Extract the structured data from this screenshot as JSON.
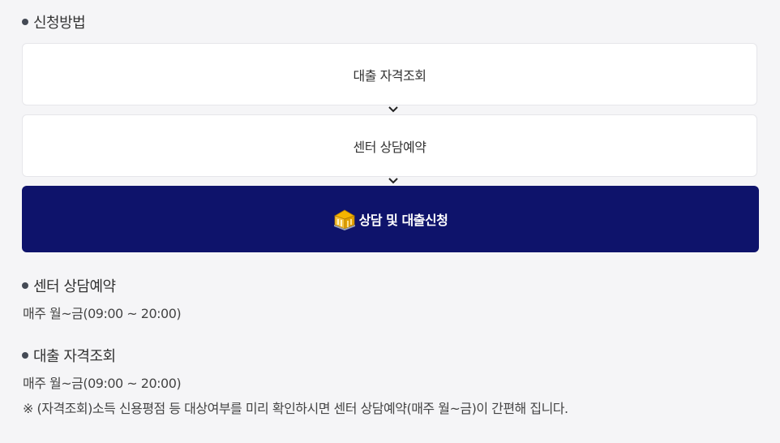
{
  "apply_method": {
    "title": "신청방법",
    "steps": [
      {
        "label": "대출 자격조회"
      },
      {
        "label": "센터 상담예약"
      }
    ],
    "cta_label": "상담 및 대출신청",
    "cta_icon": "building-icon",
    "colors": {
      "cta_background": "#0e136b",
      "page_background": "#f5f5f7"
    }
  },
  "center_booking": {
    "title": "센터 상담예약",
    "hours": "매주 월~금(09:00 ~ 20:00)"
  },
  "eligibility_check": {
    "title": "대출 자격조회",
    "hours": "매주 월~금(09:00 ~ 20:00)",
    "note": "※ (자격조회)소득 신용평점 등 대상여부를 미리 확인하시면 센터 상담예약(매주 월~금)이 간편해 집니다."
  }
}
